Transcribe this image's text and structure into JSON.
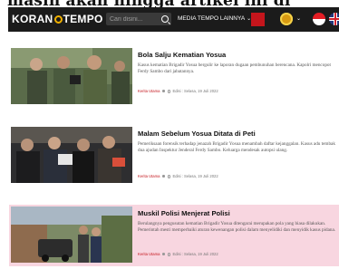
{
  "header_text": "masih akan hingga artikel ini di",
  "nav": {
    "logo_left": "KORAN",
    "logo_right": "TEMPO",
    "search_placeholder": "Cari disini...",
    "menu_label": "MEDIA TEMPO LAINNYA",
    "chevron": "⌄",
    "brand_color": "#c4151c",
    "accent_color": "#f0b000"
  },
  "articles": [
    {
      "title": "Bola Salju Kematian Yosua",
      "excerpt": "Kasus kematian Brigadir Yosua bergulir ke laporan dugaan pembunuhan berencana. Kapolri mencopot Ferdy Sambo dari jabatannya.",
      "author": "Kerita Utama",
      "date": "Edisi : Selasa, 19 Juli 2022"
    },
    {
      "title": "Malam Sebelum Yosua Ditata di Peti",
      "excerpt": "Pemeriksaan forensik terhadap jenazah Brigadir Yosua menambah daftar kejanggalan. Kasus adu tembak dua ajudan Inspektur Jenderal Ferdy Sambo. Keluarga mendesak autopsi ulang.",
      "author": "Kerita Utama",
      "date": "Edisi : Selasa, 19 Juli 2022"
    },
    {
      "title": "Muskil Polisi Menjerat Polisi",
      "excerpt": "Berulangnya pengusutan kematian Brigadir Yosua ditengarai merupakan pola yang biasa dilakukan. Pemerintah mesti memperbaiki aturan kewenangan polisi dalam menyelidiki dan menyidik kasus pidana.",
      "author": "Kerita Utama",
      "date": "Edisi : Selasa, 19 Juli 2022",
      "highlight_color": "#f8d6e0"
    }
  ]
}
